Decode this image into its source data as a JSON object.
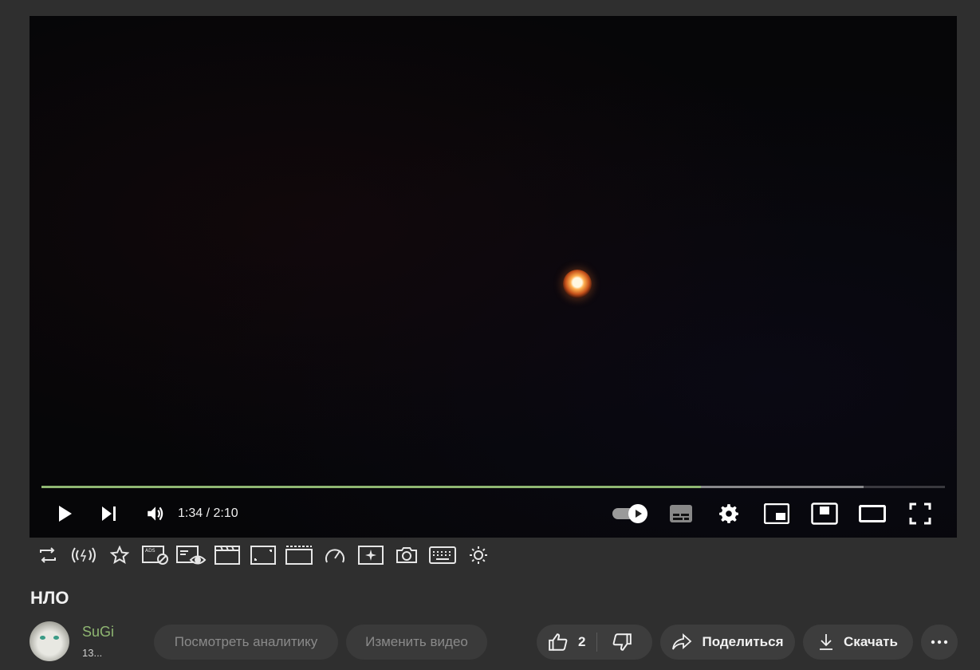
{
  "player": {
    "time_display": "1:34 / 2:10",
    "progress_played_fraction": 0.73,
    "progress_loaded_fraction": 0.91,
    "autoplay_on": true,
    "accent_color": "#8fb672"
  },
  "controls_left": [
    "play-icon",
    "next-icon",
    "volume-icon"
  ],
  "controls_right": [
    "autoplay-toggle",
    "subtitles-icon",
    "settings-gear-icon",
    "miniplayer-icon",
    "picture-in-picture-icon",
    "theater-mode-icon",
    "fullscreen-icon"
  ],
  "toolbar_icons": [
    "loop-icon",
    "broadcast-icon",
    "star-icon",
    "ads-block-icon",
    "view-count-icon",
    "clapperboard-icon",
    "aspect-ratio-icon",
    "cinema-mode-icon",
    "speedometer-icon",
    "enhance-sparkle-icon",
    "screenshot-camera-icon",
    "keyboard-icon",
    "settings-sun-icon"
  ],
  "video": {
    "title": "НЛО"
  },
  "channel": {
    "name": "SuGi",
    "subscribers": "13..."
  },
  "actions": {
    "analytics_label": "Посмотреть аналитику",
    "edit_label": "Изменить видео",
    "like_count": "2",
    "share_label": "Поделиться",
    "download_label": "Скачать"
  }
}
